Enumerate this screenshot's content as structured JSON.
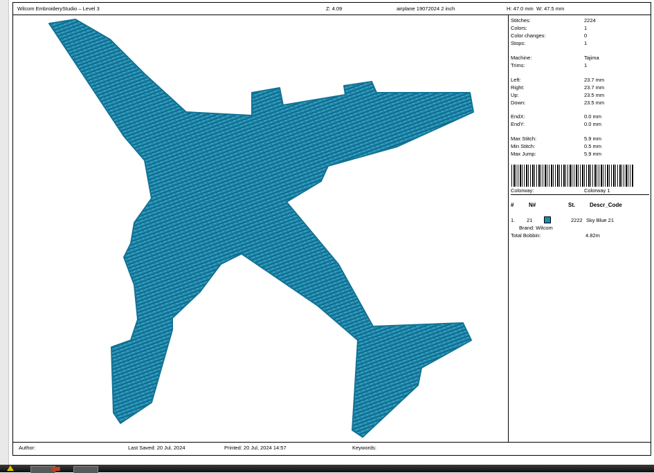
{
  "header": {
    "app_title": "Wilcom EmbroideryStudio – Level 3",
    "zoom": "Z: 4.09",
    "design_name": "airplane 19072024 2 inch",
    "height": "H: 47.0 mm",
    "width": "W: 47.5 mm"
  },
  "stats": [
    {
      "label": "Stitches:",
      "value": "2224"
    },
    {
      "label": "Colors:",
      "value": "1"
    },
    {
      "label": "Color changes:",
      "value": "0"
    },
    {
      "label": "Stops:",
      "value": "1"
    },
    {
      "label": "Machine:",
      "value": "Tajima"
    },
    {
      "label": "Trims:",
      "value": "1"
    },
    {
      "label": "Left:",
      "value": "23.7 mm"
    },
    {
      "label": "Right:",
      "value": "23.7 mm"
    },
    {
      "label": "Up:",
      "value": "23.5 mm"
    },
    {
      "label": "Down:",
      "value": "23.5 mm"
    },
    {
      "label": "EndX:",
      "value": "0.0 mm"
    },
    {
      "label": "EndY:",
      "value": "0.0 mm"
    },
    {
      "label": "Max Stitch:",
      "value": "5.9 mm"
    },
    {
      "label": "Min Stitch:",
      "value": "0.5 mm"
    },
    {
      "label": "Max Jump:",
      "value": "5.9 mm"
    }
  ],
  "colorway": {
    "label": "Colorway:",
    "value": "Colorway 1"
  },
  "color_table": {
    "headers": {
      "num": "#",
      "n_num": "N#",
      "st": "St.",
      "descr": "Descr_Code"
    },
    "rows": [
      {
        "num": "1.",
        "n_num": "21",
        "color": "#1f8ab0",
        "st": "2222",
        "descr": "Sky Blue 21",
        "brand": "Brand: Wilcom"
      }
    ],
    "total_bobbin_label": "Total Bobbin:",
    "total_bobbin_value": "4.82m"
  },
  "footer": {
    "author": "Author:",
    "last_saved": "Last Saved: 20 Jul, 2024",
    "printed": "Printed: 20 Jul, 2024 14:57",
    "keywords": "Keywords:"
  },
  "design": {
    "thread_color": "#1f8ab0",
    "shape": "airplane"
  }
}
